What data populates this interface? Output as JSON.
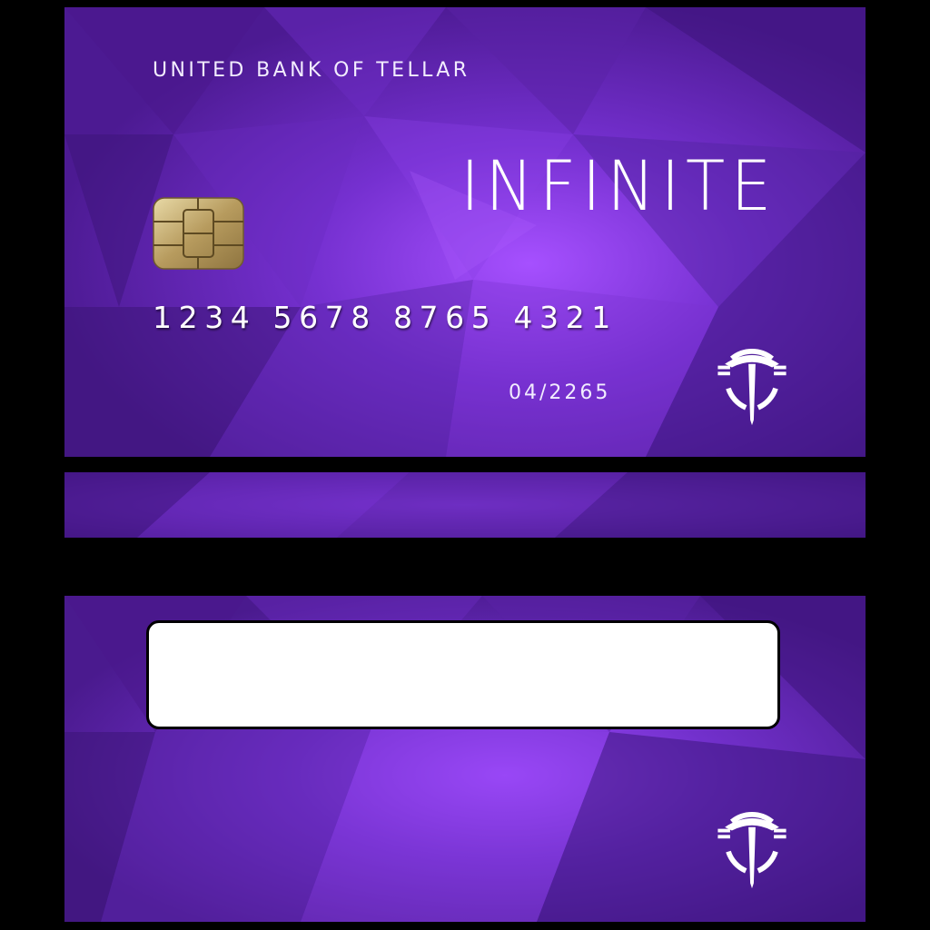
{
  "card_front": {
    "bank_name": "UNITED BANK OF TELLAR",
    "tier": "INFINITE",
    "card_number": "1234 5678 8765 4321",
    "expiry": "04/2265",
    "chip_icon": "emv-chip-icon",
    "logo_icon": "tellar-logo-icon"
  },
  "card_back": {
    "signature_box": "",
    "logo_icon": "tellar-logo-icon"
  },
  "colors": {
    "card_base": "#5a22a6",
    "card_highlight": "#9a48ff",
    "card_dark": "#3a1478",
    "chip_gold": "#c9b27a",
    "text": "#ffffff",
    "background": "#000000"
  }
}
